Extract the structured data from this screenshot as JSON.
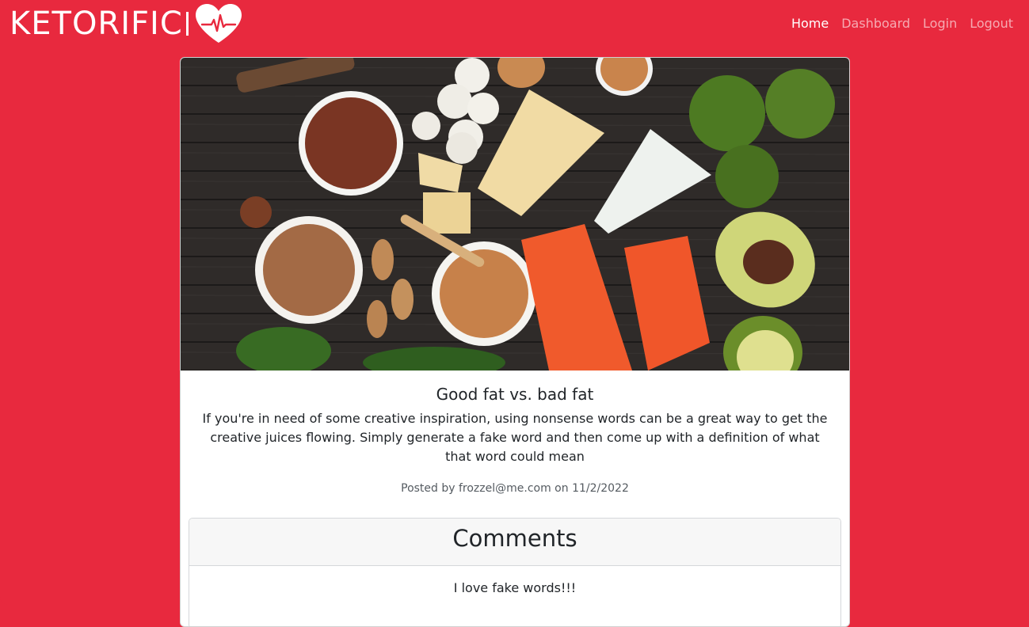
{
  "brand": {
    "name": "KETORIFIC",
    "logo_icon": "heart-pulse-icon"
  },
  "nav": {
    "items": [
      {
        "label": "Home",
        "active": true
      },
      {
        "label": "Dashboard",
        "active": false
      },
      {
        "label": "Login",
        "active": false
      },
      {
        "label": "Logout",
        "active": false
      }
    ]
  },
  "post": {
    "title": "Good fat vs. bad fat",
    "body": "If you're in need of some creative inspiration, using nonsense words can be a great way to get the creative juices flowing. Simply generate a fake word and then come up with a definition of what that word could mean",
    "meta": "Posted by frozzel@me.com on 11/2/2022"
  },
  "comments": {
    "header": "Comments",
    "items": [
      {
        "text": "I love fake words!!!"
      }
    ]
  },
  "colors": {
    "background": "#e8293e",
    "card": "#ffffff",
    "nav_active": "#ffffff"
  }
}
